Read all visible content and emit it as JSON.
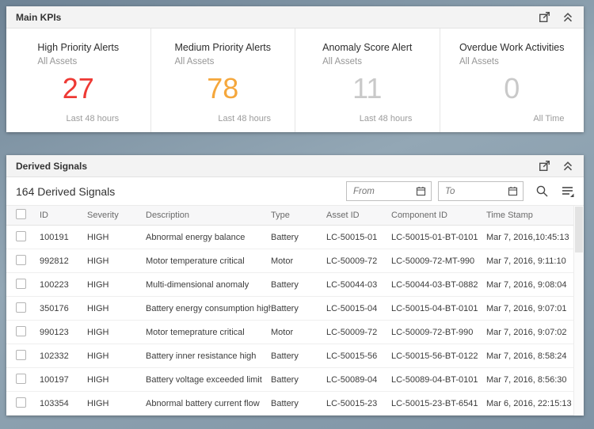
{
  "kpi_panel": {
    "title": "Main KPIs",
    "tiles": [
      {
        "title": "High Priority Alerts",
        "subtitle": "All Assets",
        "value": "27",
        "value_color": "#ee3934",
        "footer": "Last 48 hours"
      },
      {
        "title": "Medium Priority Alerts",
        "subtitle": "All Assets",
        "value": "78",
        "value_color": "#f5a73c",
        "footer": "Last 48 hours"
      },
      {
        "title": "Anomaly Score Alert",
        "subtitle": "All Assets",
        "value": "11",
        "value_color": "#c9c9c9",
        "footer": "Last 48 hours"
      },
      {
        "title": "Overdue Work Activities",
        "subtitle": "All Assets",
        "value": "0",
        "value_color": "#c9c9c9",
        "footer": "All Time"
      }
    ]
  },
  "signals_panel": {
    "title": "Derived Signals",
    "count_label": "164 Derived Signals",
    "filters": {
      "from_placeholder": "From",
      "to_placeholder": "To"
    },
    "columns": [
      "ID",
      "Severity",
      "Description",
      "Type",
      "Asset ID",
      "Component ID",
      "Time Stamp"
    ],
    "rows": [
      {
        "id": "100191",
        "severity": "HIGH",
        "description": "Abnormal energy balance",
        "type": "Battery",
        "asset_id": "LC-50015-01",
        "component_id": "LC-50015-01-BT-0101",
        "timestamp": "Mar 7, 2016,10:45:13"
      },
      {
        "id": "992812",
        "severity": "HIGH",
        "description": "Motor temperature critical",
        "type": "Motor",
        "asset_id": "LC-50009-72",
        "component_id": "LC-50009-72-MT-990",
        "timestamp": "Mar 7, 2016, 9:11:10"
      },
      {
        "id": "100223",
        "severity": "HIGH",
        "description": "Multi-dimensional anomaly",
        "type": "Battery",
        "asset_id": "LC-50044-03",
        "component_id": "LC-50044-03-BT-0882",
        "timestamp": "Mar 7, 2016, 9:08:04"
      },
      {
        "id": "350176",
        "severity": "HIGH",
        "description": "Battery energy consumption high",
        "type": "Battery",
        "asset_id": "LC-50015-04",
        "component_id": "LC-50015-04-BT-0101",
        "timestamp": "Mar 7, 2016, 9:07:01"
      },
      {
        "id": "990123",
        "severity": "HIGH",
        "description": "Motor temeprature critical",
        "type": "Motor",
        "asset_id": "LC-50009-72",
        "component_id": "LC-50009-72-BT-990",
        "timestamp": "Mar 7, 2016, 9:07:02"
      },
      {
        "id": "102332",
        "severity": "HIGH",
        "description": "Battery inner resistance high",
        "type": "Battery",
        "asset_id": "LC-50015-56",
        "component_id": "LC-50015-56-BT-0122",
        "timestamp": "Mar 7, 2016, 8:58:24"
      },
      {
        "id": "100197",
        "severity": "HIGH",
        "description": "Battery voltage exceeded limit",
        "type": "Battery",
        "asset_id": "LC-50089-04",
        "component_id": "LC-50089-04-BT-0101",
        "timestamp": "Mar 7, 2016, 8:56:30"
      },
      {
        "id": "103354",
        "severity": "HIGH",
        "description": "Abnormal battery current flow",
        "type": "Battery",
        "asset_id": "LC-50015-23",
        "component_id": "LC-50015-23-BT-6541",
        "timestamp": "Mar 6, 2016, 22:15:13"
      }
    ]
  },
  "icons": {
    "panel_actions": [
      "open-in-new-window-icon",
      "collapse-icon"
    ],
    "toolbar": [
      "calendar-icon",
      "search-icon",
      "view-settings-icon"
    ]
  },
  "colors": {
    "high_alert": "#ee3934",
    "medium_alert": "#f5a73c",
    "neutral_value": "#c9c9c9",
    "page_background": "#8aa0b0"
  }
}
